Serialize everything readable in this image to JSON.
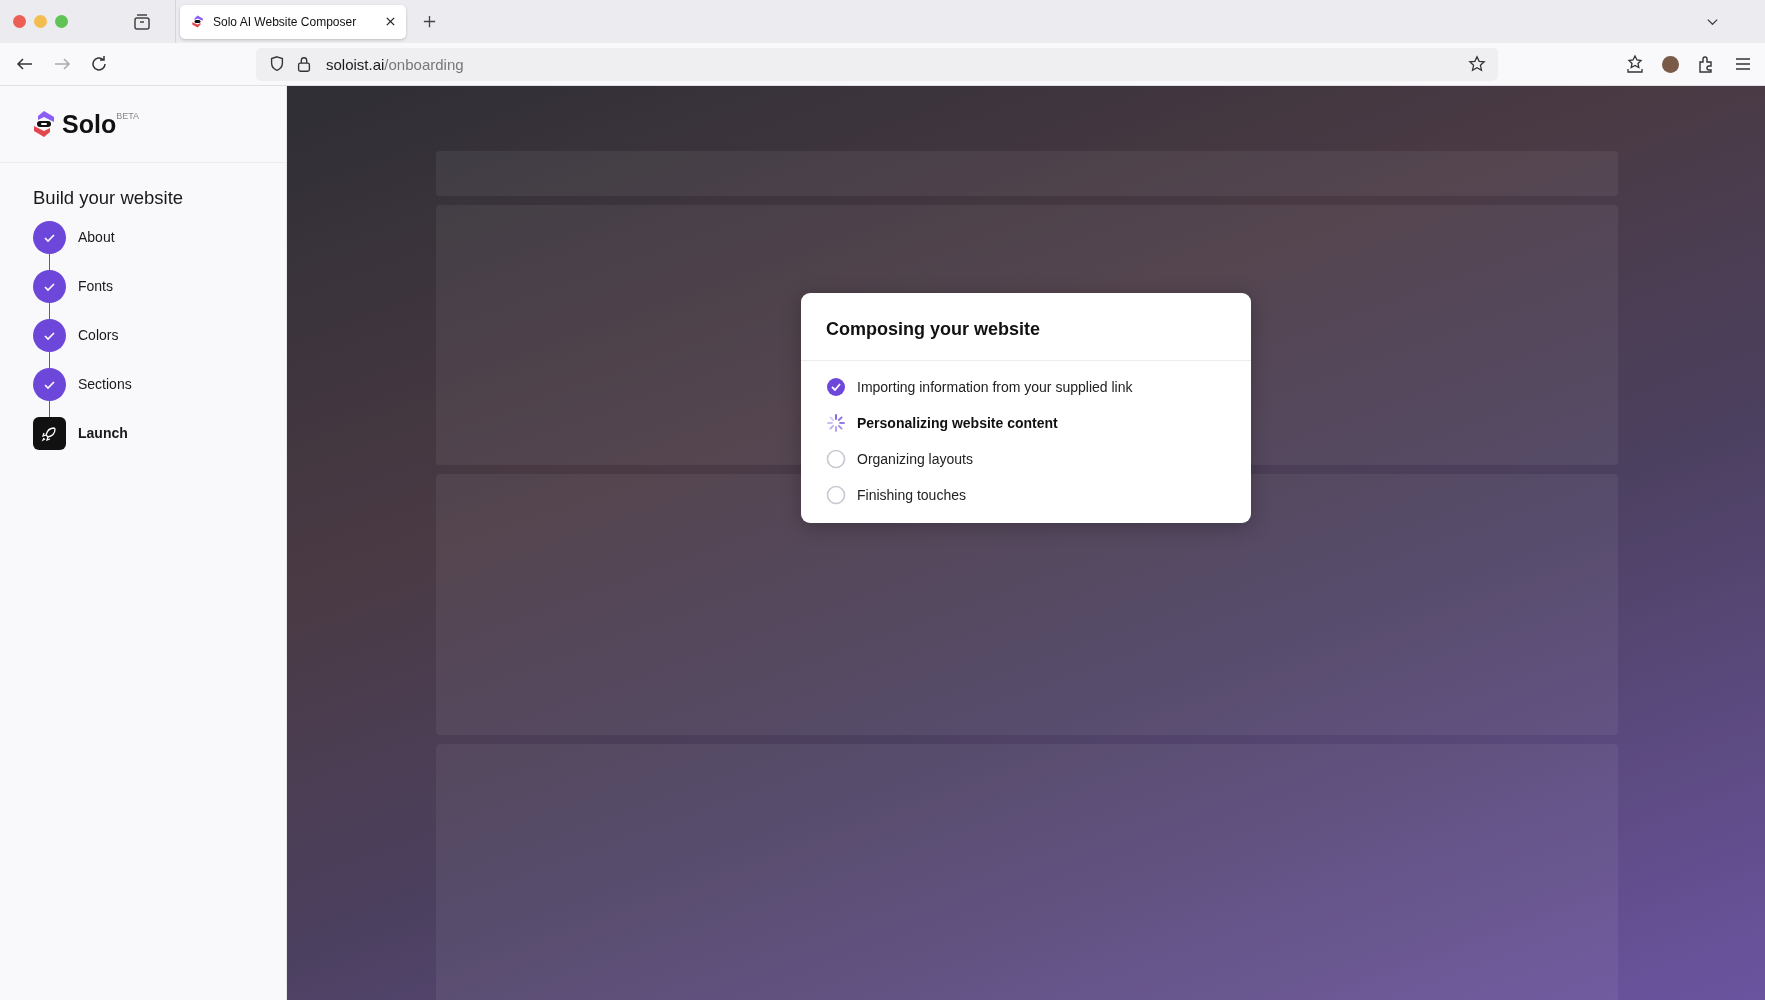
{
  "browser": {
    "tab": {
      "title": "Solo AI Website Composer",
      "selected": true
    },
    "url_host": "soloist.ai",
    "url_path": "/onboarding"
  },
  "sidebar": {
    "brand": "Solo",
    "badge": "BETA",
    "heading": "Build your website",
    "steps": [
      {
        "label": "About",
        "kind": "done"
      },
      {
        "label": "Fonts",
        "kind": "done"
      },
      {
        "label": "Colors",
        "kind": "done"
      },
      {
        "label": "Sections",
        "kind": "done"
      },
      {
        "label": "Launch",
        "kind": "current"
      }
    ]
  },
  "dialog": {
    "title": "Composing your website",
    "tasks": [
      {
        "label": "Importing information from your supplied link",
        "kind": "done"
      },
      {
        "label": "Personalizing website content",
        "kind": "active"
      },
      {
        "label": "Organizing layouts",
        "kind": "pending"
      },
      {
        "label": "Finishing touches",
        "kind": "pending"
      }
    ]
  }
}
